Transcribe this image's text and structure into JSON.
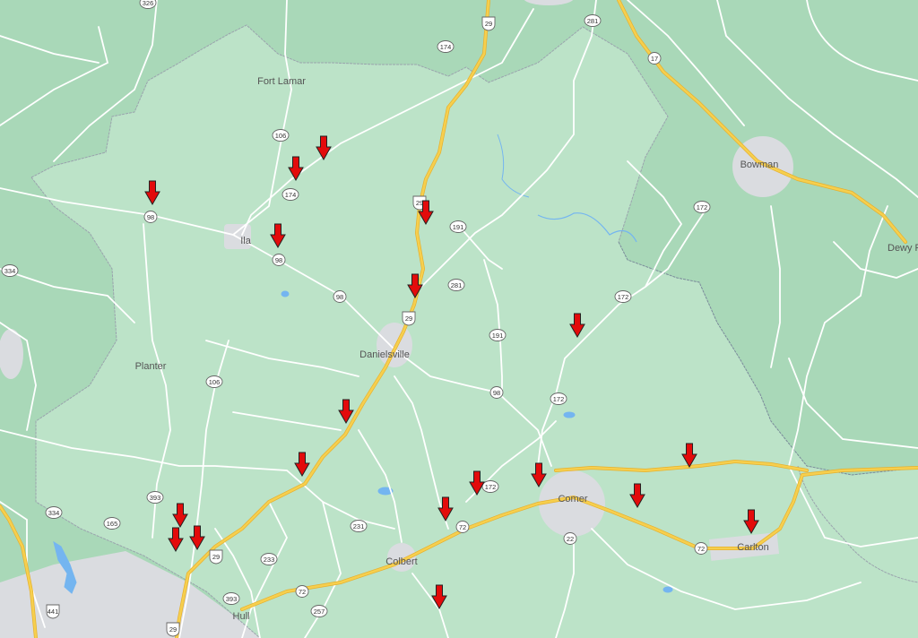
{
  "colors": {
    "outside": "#a9d8b8",
    "county": "#bce3c8",
    "urban": "#dadce0",
    "highway": "#f6cf4e",
    "highway_edge": "#e6b02d",
    "road": "#ffffff",
    "border": "#9aa3ad",
    "water": "#74b5f0",
    "marker": "#e30b0b"
  },
  "places": [
    {
      "id": "fort-lamar",
      "name": "Fort Lamar"
    },
    {
      "id": "ila",
      "name": "Ila"
    },
    {
      "id": "planter",
      "name": "Planter"
    },
    {
      "id": "danielsville",
      "name": "Danielsville"
    },
    {
      "id": "bowman",
      "name": "Bowman"
    },
    {
      "id": "dewy-rose",
      "name": "Dewy R"
    },
    {
      "id": "comer",
      "name": "Comer"
    },
    {
      "id": "carlton",
      "name": "Carlton"
    },
    {
      "id": "colbert",
      "name": "Colbert"
    },
    {
      "id": "hull",
      "name": "Hull"
    }
  ],
  "route_shields": [
    {
      "id": "326",
      "label": "326",
      "type": "state"
    },
    {
      "id": "29a",
      "label": "29",
      "type": "us"
    },
    {
      "id": "174a",
      "label": "174",
      "type": "state"
    },
    {
      "id": "281a",
      "label": "281",
      "type": "state"
    },
    {
      "id": "17",
      "label": "17",
      "type": "state"
    },
    {
      "id": "106a",
      "label": "106",
      "type": "state"
    },
    {
      "id": "174b",
      "label": "174",
      "type": "state"
    },
    {
      "id": "98a",
      "label": "98",
      "type": "state"
    },
    {
      "id": "29b",
      "label": "29",
      "type": "us"
    },
    {
      "id": "191a",
      "label": "191",
      "type": "state"
    },
    {
      "id": "98b",
      "label": "98",
      "type": "state"
    },
    {
      "id": "172a",
      "label": "172",
      "type": "state"
    },
    {
      "id": "334a",
      "label": "334",
      "type": "state"
    },
    {
      "id": "98c",
      "label": "98",
      "type": "state"
    },
    {
      "id": "281b",
      "label": "281",
      "type": "state"
    },
    {
      "id": "172b",
      "label": "172",
      "type": "state"
    },
    {
      "id": "29c",
      "label": "29",
      "type": "us"
    },
    {
      "id": "191b",
      "label": "191",
      "type": "state"
    },
    {
      "id": "106b",
      "label": "106",
      "type": "state"
    },
    {
      "id": "98d",
      "label": "98",
      "type": "state"
    },
    {
      "id": "172c",
      "label": "172",
      "type": "state"
    },
    {
      "id": "172d",
      "label": "172",
      "type": "state"
    },
    {
      "id": "393a",
      "label": "393",
      "type": "state"
    },
    {
      "id": "334b",
      "label": "334",
      "type": "state"
    },
    {
      "id": "165",
      "label": "165",
      "type": "state"
    },
    {
      "id": "72a",
      "label": "72",
      "type": "state"
    },
    {
      "id": "231",
      "label": "231",
      "type": "state"
    },
    {
      "id": "22",
      "label": "22",
      "type": "state"
    },
    {
      "id": "72b",
      "label": "72",
      "type": "state"
    },
    {
      "id": "29d",
      "label": "29",
      "type": "us"
    },
    {
      "id": "233",
      "label": "233",
      "type": "state"
    },
    {
      "id": "393b",
      "label": "393",
      "type": "state"
    },
    {
      "id": "72c",
      "label": "72",
      "type": "state"
    },
    {
      "id": "257",
      "label": "257",
      "type": "state"
    },
    {
      "id": "441",
      "label": "441",
      "type": "us"
    },
    {
      "id": "29e",
      "label": "29",
      "type": "us"
    }
  ],
  "markers": [
    {
      "id": "m1",
      "icon": "down-arrow-marker"
    },
    {
      "id": "m2",
      "icon": "down-arrow-marker"
    },
    {
      "id": "m3",
      "icon": "down-arrow-marker"
    },
    {
      "id": "m4",
      "icon": "down-arrow-marker"
    },
    {
      "id": "m5",
      "icon": "down-arrow-marker"
    },
    {
      "id": "m6",
      "icon": "down-arrow-marker"
    },
    {
      "id": "m7",
      "icon": "down-arrow-marker"
    },
    {
      "id": "m8",
      "icon": "down-arrow-marker"
    },
    {
      "id": "m9",
      "icon": "down-arrow-marker"
    },
    {
      "id": "m10",
      "icon": "down-arrow-marker"
    },
    {
      "id": "m11",
      "icon": "down-arrow-marker"
    },
    {
      "id": "m12",
      "icon": "down-arrow-marker"
    },
    {
      "id": "m13",
      "icon": "down-arrow-marker"
    },
    {
      "id": "m14",
      "icon": "down-arrow-marker"
    },
    {
      "id": "m15",
      "icon": "down-arrow-marker"
    },
    {
      "id": "m16",
      "icon": "down-arrow-marker"
    },
    {
      "id": "m17",
      "icon": "down-arrow-marker"
    },
    {
      "id": "m18",
      "icon": "down-arrow-marker"
    },
    {
      "id": "m19",
      "icon": "down-arrow-marker"
    },
    {
      "id": "m20",
      "icon": "down-arrow-marker"
    }
  ]
}
